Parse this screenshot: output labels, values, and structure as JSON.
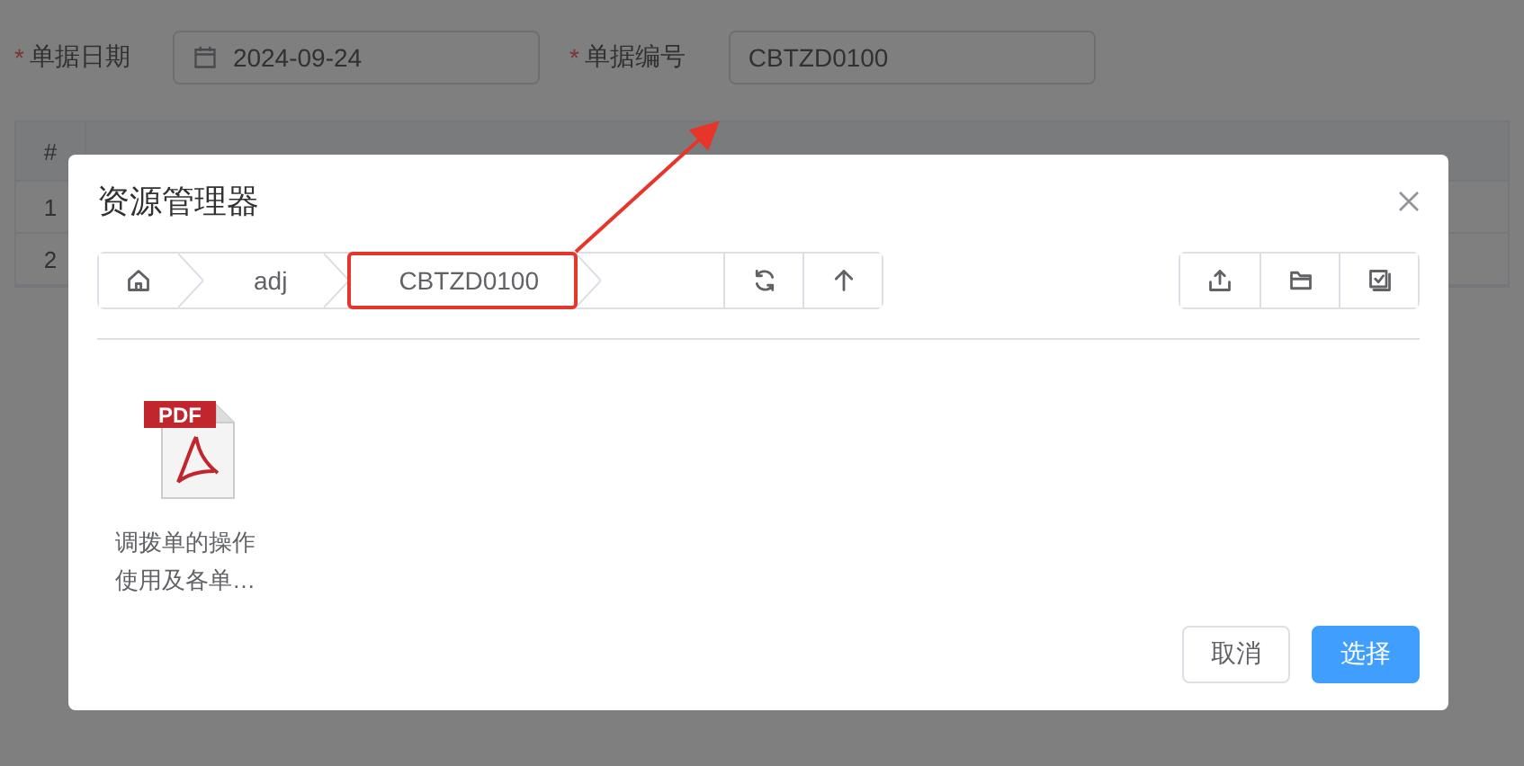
{
  "form": {
    "fields": [
      {
        "label": "单据日期",
        "required_mark": "*",
        "value": "2024-09-24",
        "kind": "date"
      },
      {
        "label": "单据编号",
        "required_mark": "*",
        "value": "CBTZD0100",
        "kind": "text"
      }
    ]
  },
  "table": {
    "columns": [
      "#"
    ],
    "rows": [
      {
        "index": "1"
      },
      {
        "index": "2"
      }
    ]
  },
  "dialog": {
    "title": "资源管理器",
    "breadcrumb": [
      {
        "kind": "home"
      },
      {
        "kind": "folder",
        "label": "adj",
        "highlighted": false
      },
      {
        "kind": "folder",
        "label": "CBTZD0100",
        "highlighted": true
      }
    ],
    "files": [
      {
        "type": "PDF",
        "name": "调拨单的操作使用及各单…"
      }
    ],
    "buttons": [
      {
        "label": "取消",
        "primary": false
      },
      {
        "label": "选择",
        "primary": true
      }
    ]
  }
}
